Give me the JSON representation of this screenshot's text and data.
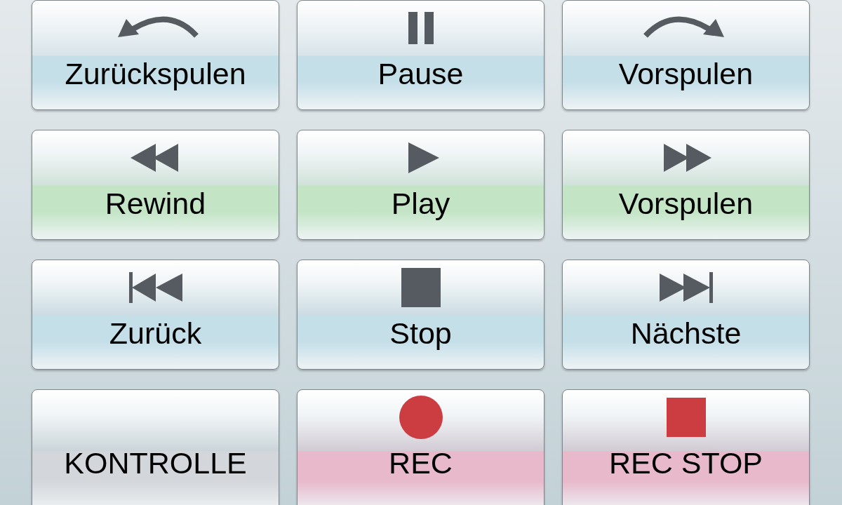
{
  "buttons": [
    {
      "label": "Zurückspulen",
      "kind": "curve-left",
      "color": "#c5dfe9"
    },
    {
      "label": "Pause",
      "kind": "pause",
      "color": "#c5dfe9"
    },
    {
      "label": "Vorspulen",
      "kind": "curve-right",
      "color": "#c5dfe9"
    },
    {
      "label": "Rewind",
      "kind": "rewind",
      "color": "#c3e5c6"
    },
    {
      "label": "Play",
      "kind": "play",
      "color": "#c3e5c6"
    },
    {
      "label": "Vorspulen",
      "kind": "fast-forward",
      "color": "#c3e5c6"
    },
    {
      "label": "Zurück",
      "kind": "skip-back",
      "color": "#c5dfe9"
    },
    {
      "label": "Stop",
      "kind": "stop",
      "color": "#c5dfe9"
    },
    {
      "label": "Nächste",
      "kind": "skip-forward",
      "color": "#c5dfe9"
    },
    {
      "label": "KONTROLLE",
      "kind": "none",
      "color": "#d3d6da"
    },
    {
      "label": "REC",
      "kind": "record",
      "color": "#e7b9cb"
    },
    {
      "label": "REC STOP",
      "kind": "record-stop",
      "color": "#e7b9cb"
    }
  ]
}
